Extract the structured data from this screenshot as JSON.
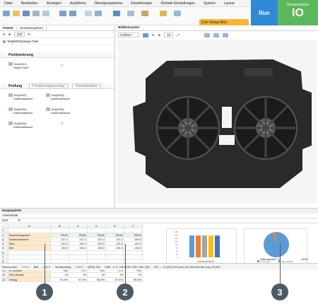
{
  "menu": [
    "Datei",
    "Bearbeiten",
    "Anzeigen",
    "Ausführen",
    "Dienstprogramme",
    "Einstellungen",
    "Globale Einstellungen",
    "System",
    "Layout"
  ],
  "run_label": "Run",
  "status": {
    "title": "Gesamtstatus",
    "value": "IO"
  },
  "mode_button": "Zum Setup-Mod",
  "left_tabs": [
    "Palette",
    "Gesamtergebnis"
  ],
  "zoom_left": "100",
  "task_label": "Task[0000]Haupt-Task",
  "sections": {
    "positioning": "Positionierung",
    "check": "Prüfung"
  },
  "check_buttons": [
    "Positionsanpassung",
    "Gesamtstatus"
  ],
  "tools": [
    {
      "id": "Tool[0001]",
      "name": "ShapeTrax3"
    },
    {
      "id": "Tool[0002]",
      "name": "Kantenabstand"
    },
    {
      "id": "Tool[0003]",
      "name": "Kantenabstand"
    },
    {
      "id": "Tool[0004]",
      "name": "Kantenabstand"
    },
    {
      "id": "Tool[0005]",
      "name": "Kantenabstand"
    },
    {
      "id": "Tool[0006]",
      "name": "Kantenabstand"
    }
  ],
  "viewer_tab": "Bildbetrachter",
  "viewer_mode": "Gefiltert",
  "viewer_zoom": "10",
  "bottom_tabs": [
    "Hauptpalette",
    "Arbeitsblatt"
  ],
  "cell_ref": "Q18",
  "fx": "fx",
  "columns": [
    "A",
    "B",
    "C",
    "D",
    "E",
    "F",
    "G",
    "H",
    "I",
    "J",
    "K",
    "L",
    "M"
  ],
  "rows": [
    {
      "n": "1",
      "label": "",
      "vals": [
        "",
        "",
        "",
        "",
        ""
      ]
    },
    {
      "n": "2",
      "label": "Beurteilungswert",
      "vals": [
        "TRUE",
        "TRUE",
        "TRUE",
        "TRUE",
        "TRUE"
      ]
    },
    {
      "n": "3",
      "label": "Kantenabstand",
      "vals": [
        "137,2",
        "137,2",
        "137,4",
        "137,2",
        "136,9"
      ]
    },
    {
      "n": "4",
      "label": "Max.",
      "vals": [
        "140,0",
        "140,0",
        "140,0",
        "140,0",
        "140,0"
      ]
    },
    {
      "n": "5",
      "label": "Min.",
      "vals": [
        "135,0",
        "135,0",
        "135,0",
        "135,0",
        "135,0"
      ]
    },
    {
      "n": "6",
      "label": "",
      "vals": [
        "",
        "",
        "",
        "",
        ""
      ]
    },
    {
      "n": "7",
      "label": "",
      "vals": [
        "",
        "",
        "",
        "",
        ""
      ]
    },
    {
      "n": "8",
      "label": "",
      "vals": [
        "",
        "",
        "",
        "",
        ""
      ]
    },
    {
      "n": "9",
      "label": "Anzahl der Ausführungen",
      "vals": [
        "1000",
        "1000",
        "1000",
        "1000",
        "1000"
      ]
    },
    {
      "n": "10",
      "label": "IO-Anzahl",
      "vals": [
        "960",
        "970",
        "960",
        "975",
        "990"
      ]
    },
    {
      "n": "11",
      "label": "NIO-Anzahl",
      "vals": [
        "40",
        "30",
        "40",
        "25",
        "10"
      ]
    },
    {
      "n": "12",
      "label": "Ertrag",
      "vals": [
        "97,0%",
        "97,0%",
        "96,0%",
        "97,5%",
        "99,0%"
      ]
    }
  ],
  "bar_chart_xlabel": "Kantenabstand",
  "bar_chart_ticks": [
    "160",
    "140",
    "120",
    "100",
    "80",
    "60",
    "40",
    "20",
    "0"
  ],
  "pie_legend": [
    "IO-Anzahl",
    "NIO-Anzahl"
  ],
  "chart_data": [
    {
      "type": "bar",
      "categories": [
        "1",
        "2",
        "3",
        "4",
        "5"
      ],
      "values": [
        137.2,
        137.2,
        137.4,
        137.2,
        136.9
      ],
      "ylim": [
        0,
        160
      ],
      "xlabel": "Kantenabstand",
      "colors": [
        "#5b9bd5",
        "#ed7d31",
        "#a5a5a5",
        "#ffc000",
        "#4472c4"
      ]
    },
    {
      "type": "pie",
      "categories": [
        "IO-Anzahl",
        "NIO-Anzahl"
      ],
      "values": [
        960,
        40
      ],
      "colors": [
        "#5b9bd5",
        "#ed7d31"
      ]
    }
  ],
  "sheet_footer": "Datenanzahl: 0",
  "footer_zoom": "110%",
  "statusbar": [
    "Ressourcen",
    "3,00%",
    "Bild",
    "4,48%",
    "Verarbeitung",
    "0,60%",
    "(2528, 82)",
    "HSB : 0, 0, 255 RGB: 255, 255, 255",
    "OK ---- % (0/0) Zeit (ms) 40,025 Intervall (ms) 40,025"
  ],
  "callouts": [
    "1",
    "2",
    "3"
  ]
}
